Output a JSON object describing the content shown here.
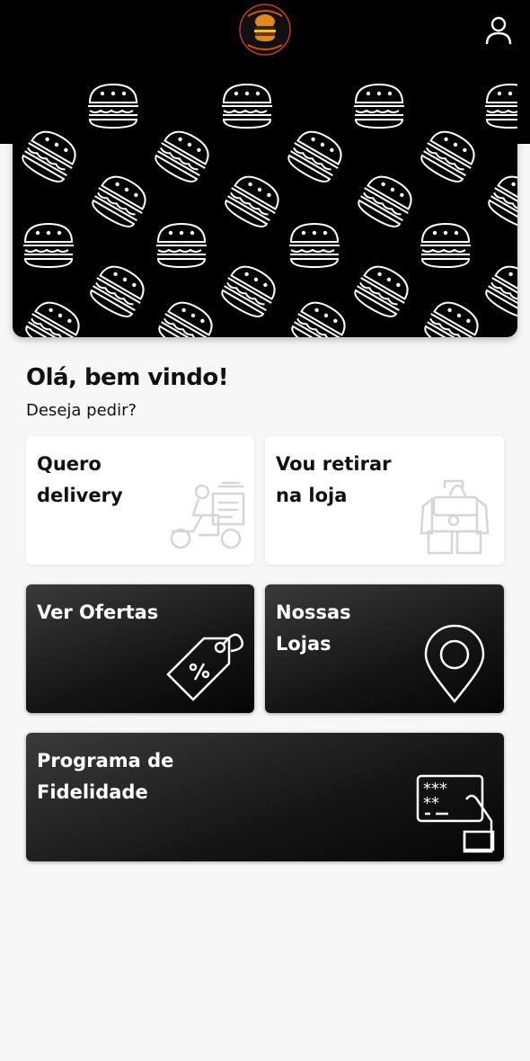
{
  "header": {
    "logo_icon": "burger-logo",
    "user_icon": "user-icon"
  },
  "banner": {
    "pattern_icon": "burger-pattern"
  },
  "greeting": {
    "title": "Olá, bem vindo!",
    "subtitle": "Deseja pedir?"
  },
  "cards": {
    "delivery": {
      "line1": "Quero",
      "line2": "delivery",
      "icon": "delivery-scooter-icon"
    },
    "pickup": {
      "line1": "Vou retirar",
      "line2": "na loja",
      "icon": "store-pickup-icon"
    },
    "offers": {
      "line1": "Ver Ofertas",
      "line2": "",
      "icon": "discount-tag-icon"
    },
    "stores": {
      "line1": "Nossas",
      "line2": "Lojas",
      "icon": "map-pin-icon"
    },
    "loyalty": {
      "line1": "Programa de",
      "line2": "Fidelidade",
      "icon": "loyalty-card-icon"
    }
  },
  "colors": {
    "header_bg": "#000000",
    "page_bg": "#f7f7f7",
    "dark_card": "#1a1a1a",
    "light_icon": "#d6d6d6"
  }
}
